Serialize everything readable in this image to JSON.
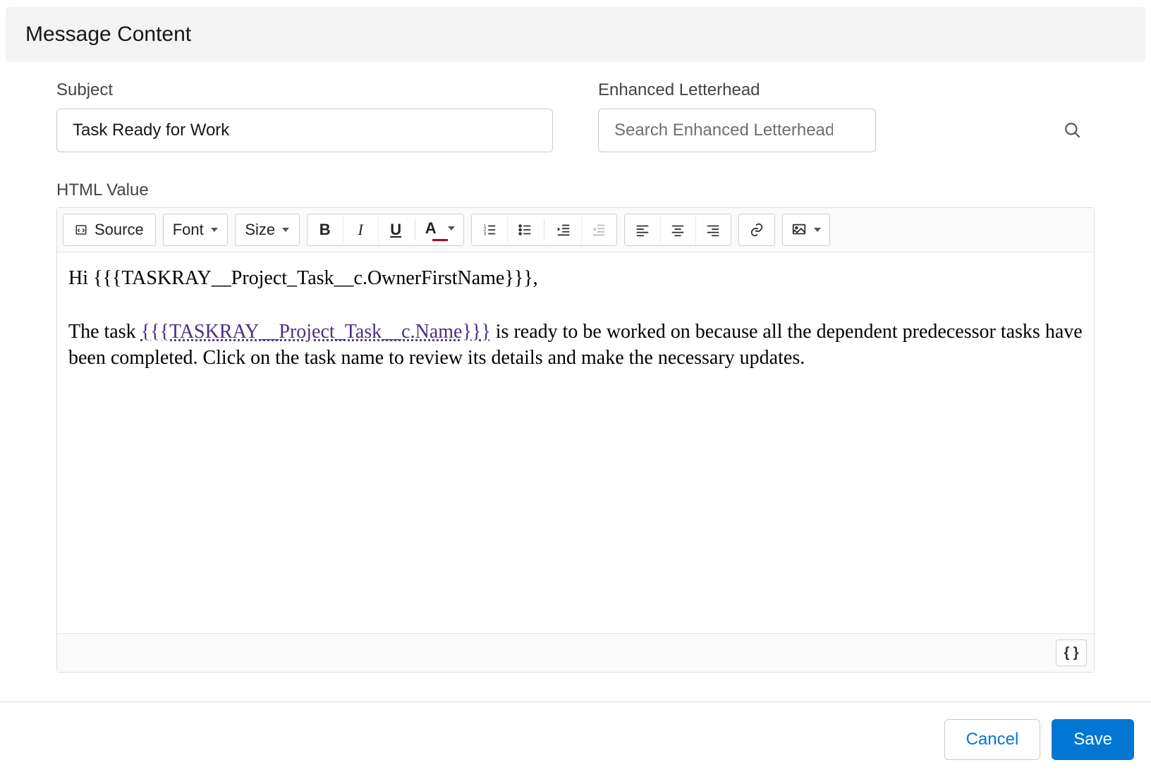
{
  "section": {
    "title": "Message Content"
  },
  "fields": {
    "subject_label": "Subject",
    "subject_value": "Task Ready for Work",
    "letterhead_label": "Enhanced Letterhead",
    "letterhead_placeholder": "Search Enhanced Letterheads...",
    "html_value_label": "HTML Value"
  },
  "toolbar": {
    "source_label": "Source",
    "font_label": "Font",
    "size_label": "Size"
  },
  "editor_content": {
    "greeting": "Hi {{{TASKRAY__Project_Task__c.OwnerFirstName}}},",
    "body_pre": "The task ",
    "link_text": "{{{TASKRAY__Project_Task__c.Name}}}",
    "body_post": " is ready to be worked on because all the dependent predecessor tasks have been completed. Click on the task name to review its details and make the necessary updates."
  },
  "merge_button_label": "{ }",
  "footer": {
    "cancel": "Cancel",
    "save": "Save"
  }
}
